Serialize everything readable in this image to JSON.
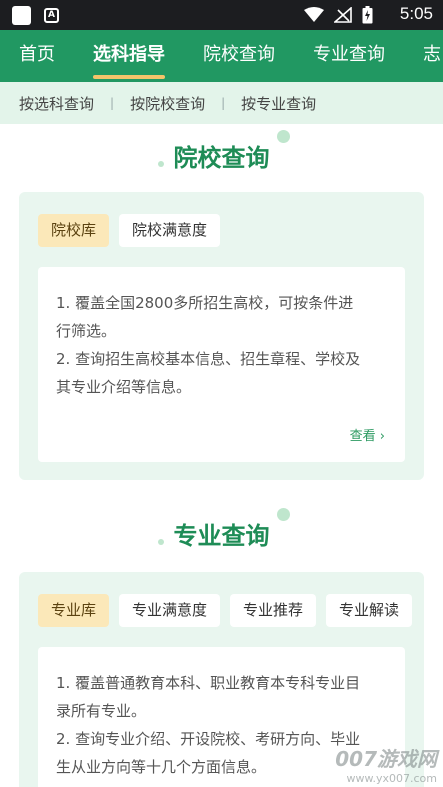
{
  "status_bar": {
    "time": "5:05",
    "icons": [
      "app-square-icon",
      "a-badge-icon",
      "wifi-icon",
      "signal-icon",
      "battery-icon"
    ],
    "a_badge": "A"
  },
  "main_nav": {
    "tabs": [
      {
        "label": "首页",
        "active": false
      },
      {
        "label": "选科指导",
        "active": true
      },
      {
        "label": "院校查询",
        "active": false
      },
      {
        "label": "专业查询",
        "active": false
      },
      {
        "label": "志",
        "active": false
      }
    ]
  },
  "sub_nav": {
    "items": [
      "按选科查询",
      "按院校查询",
      "按专业查询"
    ],
    "separator": "|"
  },
  "sections": [
    {
      "title": "院校查询",
      "chips": [
        {
          "label": "院校库",
          "active": true
        },
        {
          "label": "院校满意度",
          "active": false
        }
      ],
      "lines": [
        "1. 覆盖全国2800多所招生高校，可按条件进",
        "行筛选。",
        "2. 查询招生高校基本信息、招生章程、学校及",
        "其专业介绍等信息。"
      ],
      "more": "查看 ›"
    },
    {
      "title": "专业查询",
      "chips": [
        {
          "label": "专业库",
          "active": true
        },
        {
          "label": "专业满意度",
          "active": false
        },
        {
          "label": "专业推荐",
          "active": false
        },
        {
          "label": "专业解读",
          "active": false
        }
      ],
      "lines": [
        "1. 覆盖普通教育本科、职业教育本专科专业目",
        "录所有专业。",
        "2. 查询专业介绍、开设院校、考研方向、毕业",
        "生从业方向等十几个方面信息。"
      ]
    }
  ],
  "watermark": {
    "main": "007游戏网",
    "url": "www.yx007.com"
  },
  "colors": {
    "brand_green": "#219862",
    "title_green": "#1e8c56",
    "card_bg": "#e9f6ef",
    "chip_active": "#fbe8b9",
    "tab_indicator": "#f4c46a"
  }
}
